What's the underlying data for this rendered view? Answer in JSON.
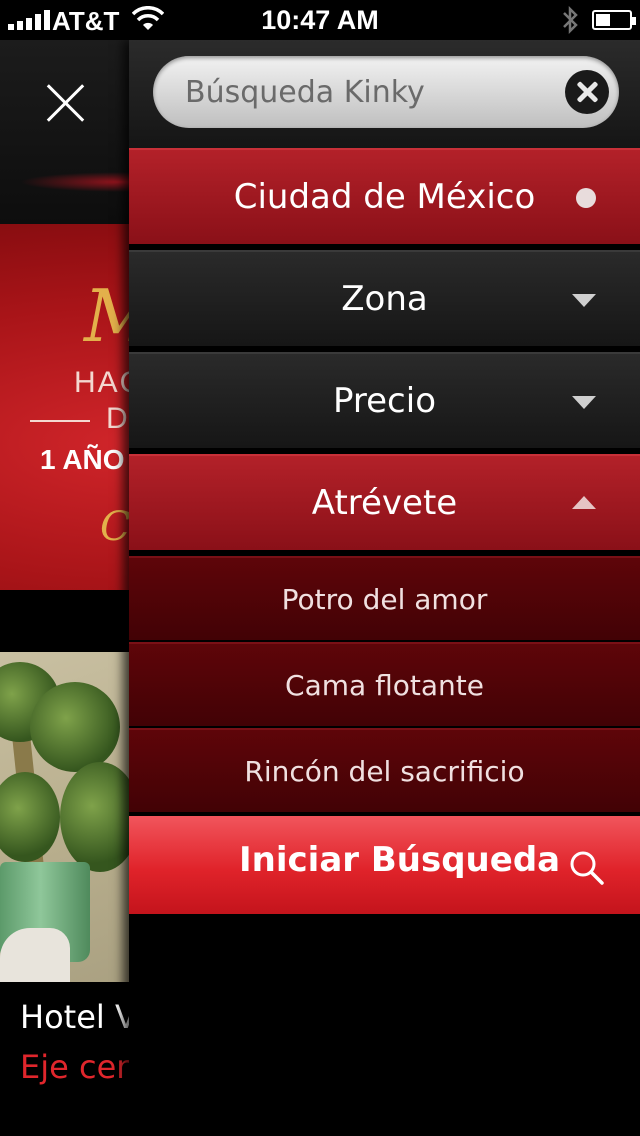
{
  "status_bar": {
    "carrier": "AT&T",
    "time": "10:47 AM"
  },
  "background_page": {
    "promo": {
      "line1": "HAC",
      "line2": "DI",
      "line3": "1 AÑO"
    },
    "hotel": {
      "name": "Hotel V",
      "address": "Eje cen"
    }
  },
  "menu": {
    "search": {
      "placeholder": "Búsqueda Kinky"
    },
    "city": {
      "label": "Ciudad de México",
      "icon": "dot-icon"
    },
    "zone": {
      "label": "Zona",
      "icon": "chevron-down-icon"
    },
    "price": {
      "label": "Precio",
      "icon": "chevron-down-icon"
    },
    "dare": {
      "label": "Atrévete",
      "icon": "chevron-up-icon",
      "options": [
        "Potro del amor",
        "Cama flotante",
        "Rincón del sacrificio"
      ]
    },
    "submit": {
      "label": "Iniciar Búsqueda",
      "icon": "search-icon"
    }
  },
  "colors": {
    "accent_red": "#e0232a",
    "row_red": "#a8181f",
    "sub_row_dark_red": "#520408",
    "address_red": "#e0262c"
  }
}
